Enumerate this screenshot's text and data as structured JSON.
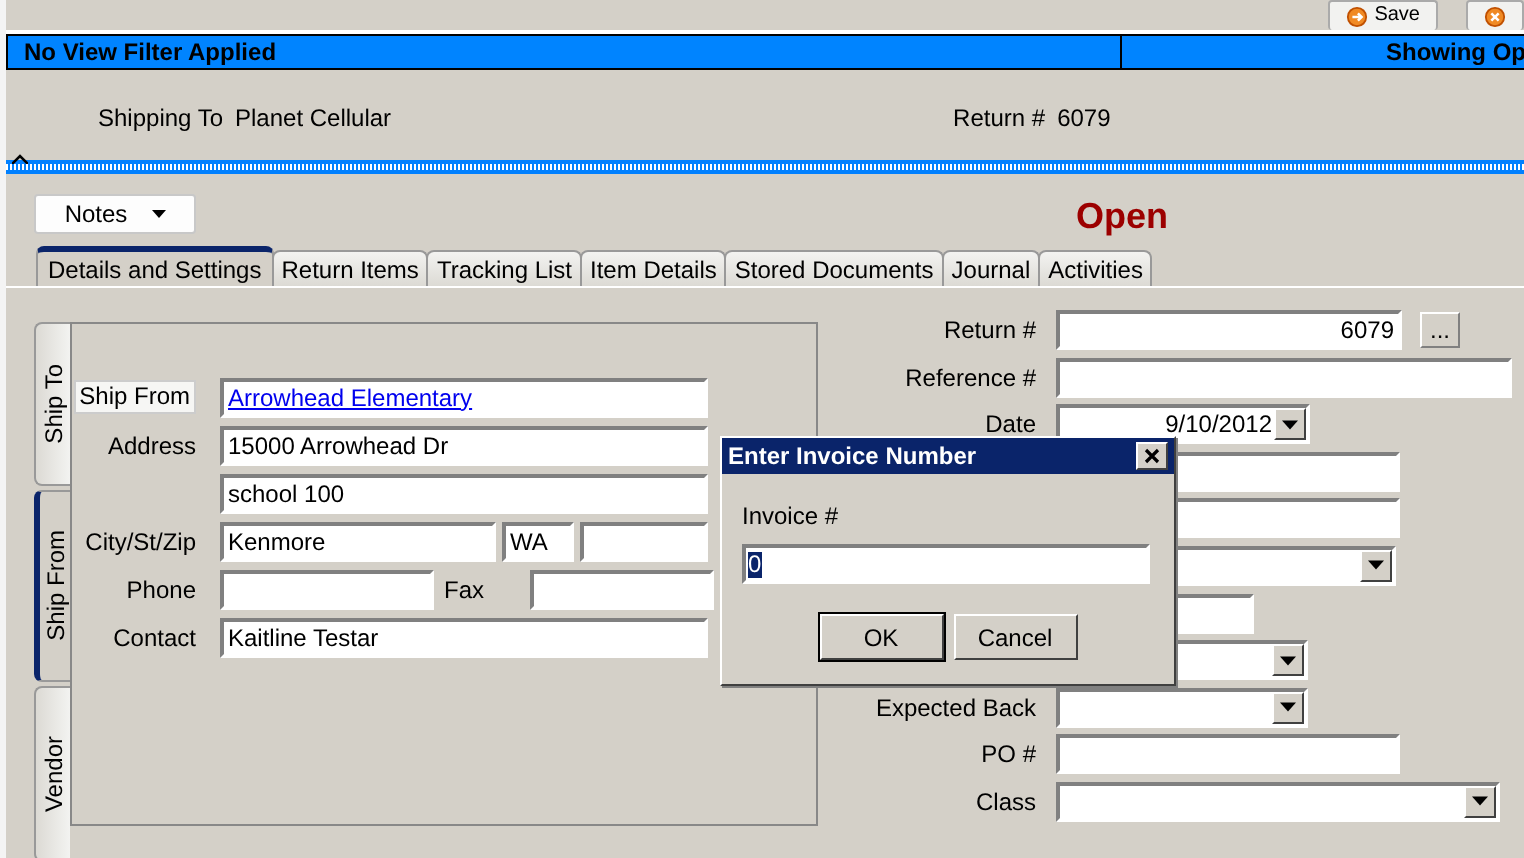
{
  "toolbar": {
    "buttons": [
      {
        "kind": "save",
        "label": "Save"
      },
      {
        "kind": "cancel"
      }
    ]
  },
  "filter_bar": {
    "filter": "No View Filter Applied",
    "showing": "Showing Op"
  },
  "header": {
    "shipping_label": "Shipping To",
    "shipping_value": "Planet Cellular",
    "return_label": "Return #",
    "return_value": "6079"
  },
  "notes_button": "Notes",
  "status": "Open",
  "tabs": [
    {
      "label": "Details and Settings",
      "selected": true
    },
    {
      "label": "Return Items",
      "selected": false
    },
    {
      "label": "Tracking List",
      "selected": false
    },
    {
      "label": "Item Details",
      "selected": false
    },
    {
      "label": "Stored Documents",
      "selected": false
    },
    {
      "label": "Journal",
      "selected": false
    },
    {
      "label": "Activities",
      "selected": false
    }
  ],
  "side_tabs": [
    {
      "label": "Ship To",
      "selected": false
    },
    {
      "label": "Ship From",
      "selected": true
    },
    {
      "label": "Vendor",
      "selected": false
    }
  ],
  "ship_rows": [
    {
      "kind": "link",
      "label": "Ship From",
      "value": "Arrowhead Elementary"
    },
    {
      "kind": "text",
      "label": "Address",
      "value": "15000 Arrowhead Dr"
    },
    {
      "kind": "text",
      "value": "school 100"
    },
    {
      "kind": "citystzip",
      "label": "City/St/Zip",
      "city": "Kenmore",
      "state": "WA"
    },
    {
      "kind": "phonefax",
      "label": "Phone",
      "fax_label": "Fax"
    },
    {
      "kind": "text",
      "label": "Contact",
      "value": "Kaitline Testar"
    }
  ],
  "details_rows": [
    {
      "kind": "lookup",
      "label": "Return #",
      "value": "6079",
      "button": "..."
    },
    {
      "kind": "wide_text",
      "label": "Reference #"
    },
    {
      "kind": "date",
      "label": "Date",
      "value": "9/10/2012"
    },
    {
      "kind": "text"
    },
    {
      "kind": "text"
    },
    {
      "kind": "dropdown"
    },
    {
      "kind": "short_text"
    },
    {
      "kind": "short_dropdown"
    },
    {
      "kind": "short_dropdown",
      "label": "Expected Back"
    },
    {
      "kind": "text",
      "label": "PO #"
    },
    {
      "kind": "wide_dropdown",
      "label": "Class"
    }
  ],
  "dialog": {
    "title": "Enter Invoice Number",
    "field_label": "Invoice #",
    "value": "0",
    "buttons": [
      {
        "label": "OK",
        "default": true
      },
      {
        "label": "Cancel",
        "default": false
      }
    ]
  }
}
